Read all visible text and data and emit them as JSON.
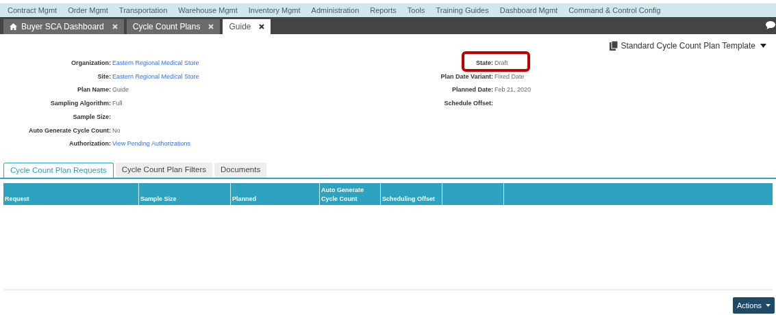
{
  "nav_menu": [
    "Contract Mgmt",
    "Order Mgmt",
    "Transportation",
    "Warehouse Mgmt",
    "Inventory Mgmt",
    "Administration",
    "Reports",
    "Tools",
    "Training Guides",
    "Dashboard Mgmt",
    "Command & Control Config"
  ],
  "page_tabs": [
    {
      "label": "Buyer SCA Dashboard",
      "kind": "home",
      "selected": false
    },
    {
      "label": "Cycle Count Plans",
      "kind": "plain",
      "selected": false
    },
    {
      "label": "Guide",
      "kind": "plain",
      "selected": true
    }
  ],
  "template_menu": {
    "label": "Standard Cycle Count Plan Template"
  },
  "left_fields": [
    {
      "label": "Organization:",
      "value": "Eastern Regional Medical Store",
      "kind": "link"
    },
    {
      "label": "Site:",
      "value": "Eastern Regional Medical Store",
      "kind": "link"
    },
    {
      "label": "Plan Name:",
      "value": "Guide",
      "kind": "text"
    },
    {
      "label": "Sampling Algorithm:",
      "value": "Full",
      "kind": "text"
    },
    {
      "label": "Sample Size:"
    },
    {
      "label": "Auto Generate Cycle Count:",
      "value": "No",
      "kind": "text"
    },
    {
      "label": "Authorization:",
      "value": "View Pending Authorizations",
      "kind": "link"
    }
  ],
  "right_fields": [
    {
      "label": "State:",
      "value": "Draft",
      "highlighted": true
    },
    {
      "label": "Plan Date Variant:",
      "value": "Fixed Date",
      "highlighted": false
    },
    {
      "label": "Planned Date:",
      "value": "Feb 21, 2020",
      "highlighted": false
    },
    {
      "label": "Schedule Offset:",
      "highlighted": false
    }
  ],
  "section_tabs": [
    {
      "label": "Cycle Count Plan Requests",
      "selected": true
    },
    {
      "label": "Cycle Count Plan Filters",
      "selected": false
    },
    {
      "label": "Documents",
      "selected": false
    }
  ],
  "table": {
    "columns": [
      "Request",
      "Sample Size",
      "Planned",
      "Auto Generate Cycle Count",
      "Scheduling Offset",
      ""
    ]
  },
  "actions_button": {
    "label": "Actions"
  }
}
